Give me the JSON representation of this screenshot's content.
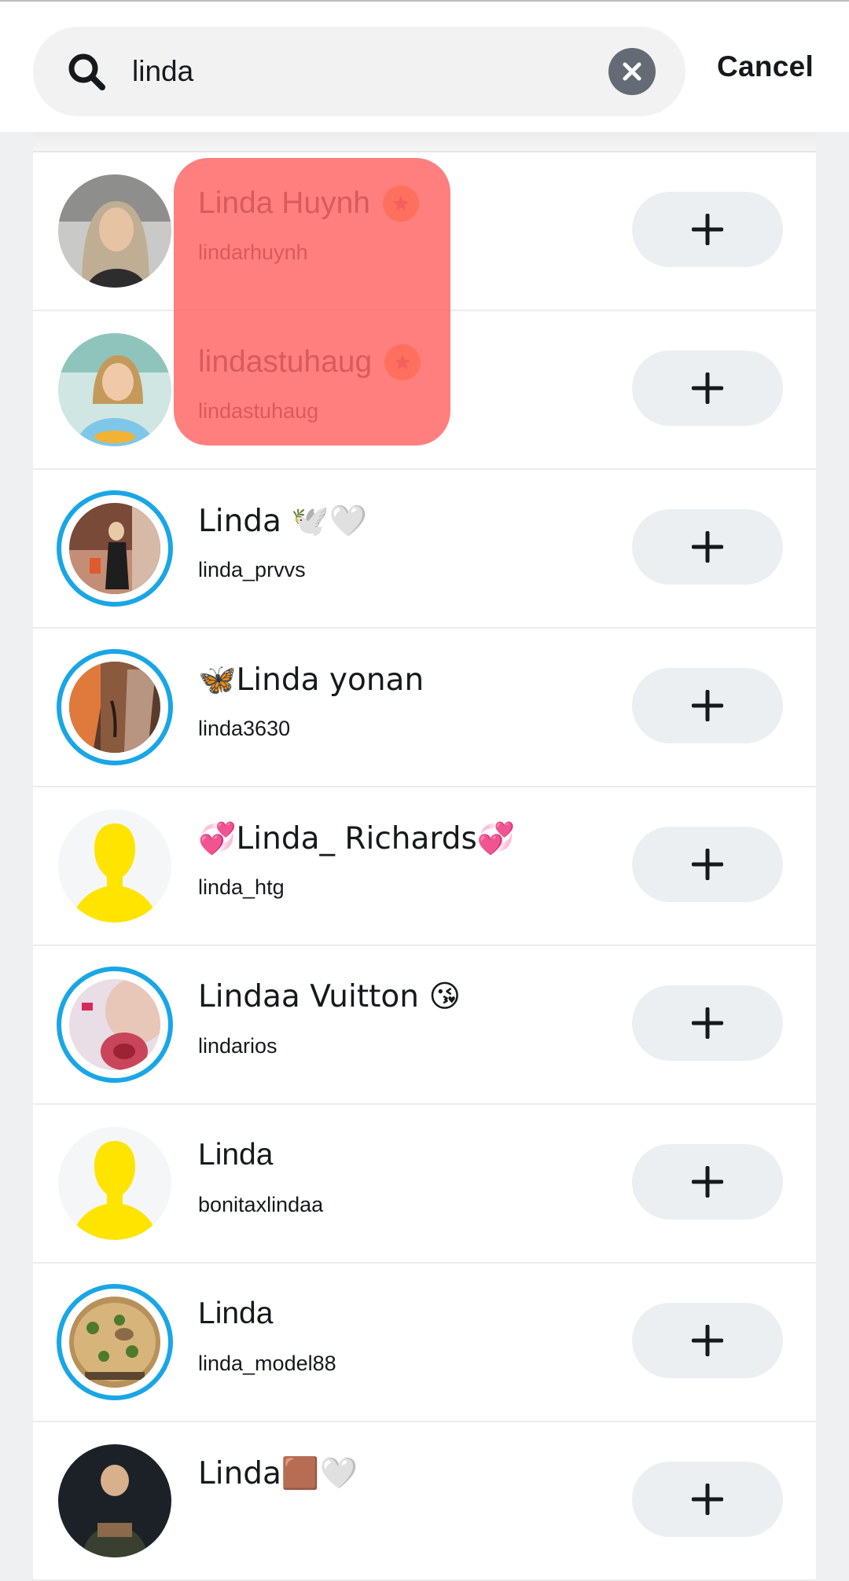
{
  "search": {
    "query": "linda",
    "cancel_label": "Cancel"
  },
  "results": [
    {
      "display_name": "Linda Huynh",
      "username": "lindarhuynh",
      "badge": "star",
      "story_ring": false,
      "avatar": "photo-blonde-woman"
    },
    {
      "display_name": "lindastuhaug",
      "username": "lindastuhaug",
      "badge": "star",
      "story_ring": false,
      "avatar": "photo-woman-blue-shirt"
    },
    {
      "display_name": "Linda 🕊️🤍",
      "username": "linda_prvvs",
      "badge": null,
      "story_ring": true,
      "avatar": "photo-mirror-selfie"
    },
    {
      "display_name": "🦋Linda yonan",
      "username": "linda3630",
      "badge": null,
      "story_ring": true,
      "avatar": "photo-abstract-brown"
    },
    {
      "display_name": "💞Linda_ Richards💞",
      "username": "linda_htg",
      "badge": null,
      "story_ring": false,
      "avatar": "default-yellow-silhouette"
    },
    {
      "display_name": "Lindaa Vuitton 😘",
      "username": "lindarios",
      "badge": null,
      "story_ring": true,
      "avatar": "photo-pink-closeup"
    },
    {
      "display_name": "Linda",
      "username": "bonitaxlindaa",
      "badge": null,
      "story_ring": false,
      "avatar": "default-yellow-silhouette"
    },
    {
      "display_name": "Linda",
      "username": "linda_model88",
      "badge": null,
      "story_ring": true,
      "avatar": "photo-food-dish"
    },
    {
      "display_name": "Linda🟫🤍",
      "username": "",
      "badge": null,
      "story_ring": false,
      "avatar": "photo-dark-person"
    }
  ],
  "colors": {
    "story_ring": "#19a6e6",
    "highlight": "#ff6666",
    "star_badge": "#f6a22f",
    "default_avatar": "#ffe400"
  }
}
